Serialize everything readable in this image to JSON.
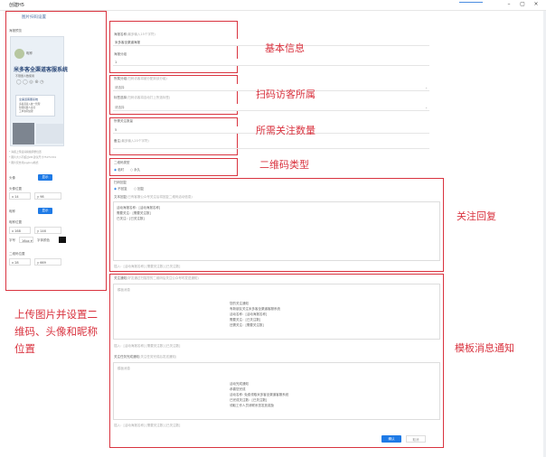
{
  "window": {
    "title": "创建H5",
    "minimize": "–",
    "maximize": "▢",
    "close": "×"
  },
  "left_panel": {
    "header": "图片扫码设置",
    "preview_label": "海报预览",
    "poster": {
      "nickname": "昵称",
      "headline": "米多客全渠道客服系统",
      "sub": "不限量人数使用",
      "card_title": "全渠道客服系统",
      "card_items": [
        "多渠道接入统一管理",
        "智能机器人接待",
        "工单协同处理"
      ]
    },
    "notes": [
      "* 海报上传后请拖拽调整位置",
      "* 图片大小不超过2M,建议尺寸750*1334",
      "* 图片仅支持jpg/png格式"
    ],
    "avatar_label": "头像",
    "avatar_upload": "显示",
    "avatar_pos_label": "头像位置",
    "avatar_x": "14",
    "avatar_y": "98",
    "nickname_label": "昵称",
    "nickname_toggle": "显示",
    "nickname_pos_label": "昵称位置",
    "nickname_x": "168",
    "nickname_y": "146",
    "font_label": "字号",
    "font_size": "16px",
    "font_color_label": "字体颜色",
    "qrcode_pos_label": "二维码位置",
    "qrcode_x": "28",
    "qrcode_y": "669",
    "annotation": "上传图片并设置二维码、头像和昵称位置"
  },
  "basic_info": {
    "annotation": "基本信息",
    "name_label": "海报名称",
    "name_hint": "(最多输入15个字符)",
    "name_value": "米多客全渠道海报",
    "group_label": "海报分组",
    "group_value": "1"
  },
  "visitor_group": {
    "annotation": "扫码访客所属",
    "group_label": "所属分组",
    "group_hint": "(扫码访客将被分配到该分组)",
    "group_placeholder": "请选择",
    "tag_label": "标签选择",
    "tag_hint": "(扫码访客将自动打上所选标签)",
    "tag_placeholder": "请选择"
  },
  "follow_count": {
    "annotation": "所需关注数量",
    "count_label": "所需关注数量",
    "count_value": "5",
    "remark_label": "备注",
    "remark_hint": "(最多输入20个字符)"
  },
  "qr_type": {
    "annotation": "二维码类型",
    "label": "二维码类型",
    "options": [
      "临时",
      "永久"
    ]
  },
  "follow_reply": {
    "annotation": "关注回复",
    "label": "扫码回复",
    "options": [
      "不回复",
      "回复"
    ],
    "text_label": "文本回复",
    "text_hint": "(已有客服公众号关注后将回复二维码活动信息)",
    "lines": [
      "活动海报名称：[活动海报名称]",
      "需要关注：[需要关注数]",
      "已关注：[已关注数]"
    ],
    "insert_hint": "插入：[活动海报名称] [需要关注数] [已关注数]"
  },
  "template_notice": {
    "annotation": "模板消息通知",
    "progress_label": "关注通知",
    "progress_hint": "(好友通过扫描您的二维码后关注公众号时发送通知)",
    "template_placeholder": "模板消息",
    "progress_lines": [
      "您的关注通知",
      "有新朋友关注米多客全渠道客服系统",
      "活动名称：[活动海报名称]",
      "需要关注：[已关注数]",
      "还需关注：[需要关注数]"
    ],
    "progress_insert": "插入：[活动海报名称] [需要关注数] [已关注数]",
    "complete_label": "关注任务完成通知",
    "complete_hint": "(关注任务完成后发送通知)",
    "complete_placeholder": "模板消息",
    "complete_lines": [
      "活动完成通知",
      "恭喜您完成",
      "活动名称: 免费领取米多客全渠道客服系统",
      "已完成关注数：[已关注数]",
      "领取工作人员请联系您发放奖励"
    ],
    "complete_insert": "插入：[活动海报名称] [需要关注数] [已关注数]",
    "confirm": "确认",
    "cancel": "取消"
  }
}
